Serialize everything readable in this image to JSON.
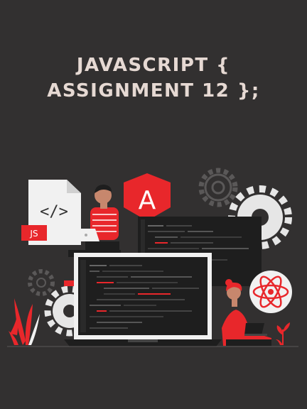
{
  "title": {
    "line1": "JAVASCRIPT {",
    "line2": "ASSIGNMENT 12 };"
  },
  "illustration": {
    "file_code_glyph": "</>",
    "file_badge": "JS",
    "framework_logo_letter": "A",
    "icons": [
      "code-file-icon",
      "angular-logo-icon",
      "gear-icon",
      "react-atom-icon",
      "plant-icon"
    ]
  },
  "colors": {
    "background": "#323030",
    "title_text": "#e6d9d3",
    "accent_red": "#e8272b",
    "panel_dark": "#1e1e1e",
    "gear_gray": "#e6e6e6"
  }
}
